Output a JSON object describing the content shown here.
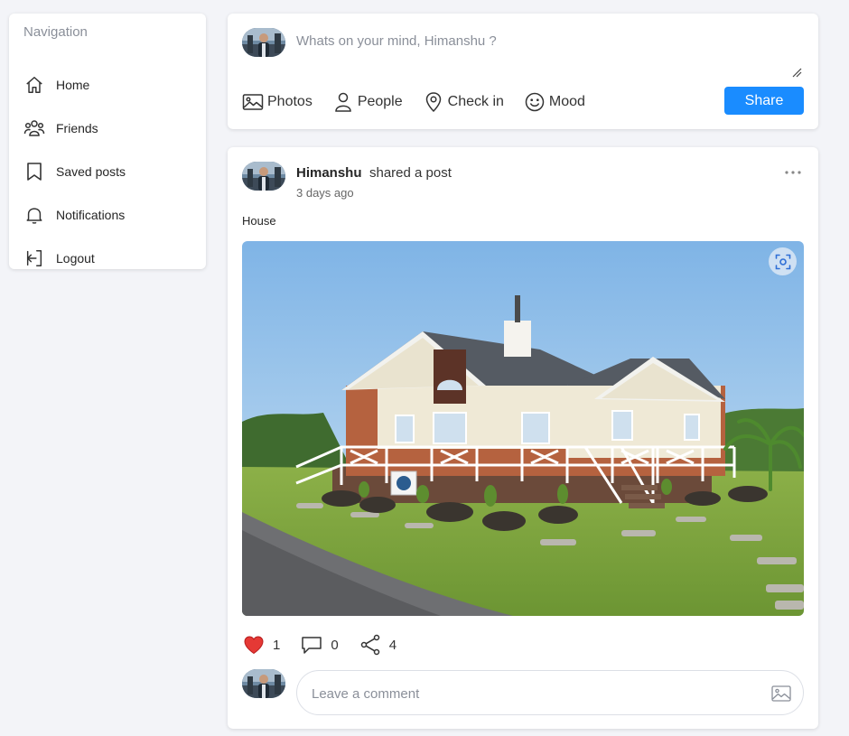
{
  "sidebar": {
    "title": "Navigation",
    "items": [
      {
        "label": "Home",
        "icon": "home-icon"
      },
      {
        "label": "Friends",
        "icon": "friends-icon"
      },
      {
        "label": "Saved posts",
        "icon": "bookmark-icon"
      },
      {
        "label": "Notifications",
        "icon": "bell-icon"
      },
      {
        "label": "Logout",
        "icon": "logout-icon"
      }
    ]
  },
  "composer": {
    "placeholder": "Whats on your mind, Himanshu ?",
    "actions": [
      {
        "label": "Photos",
        "icon": "image-icon"
      },
      {
        "label": "People",
        "icon": "person-icon"
      },
      {
        "label": "Check in",
        "icon": "location-pin-icon"
      },
      {
        "label": "Mood",
        "icon": "smiley-icon"
      }
    ],
    "share_label": "Share"
  },
  "post": {
    "author": "Himanshu",
    "action_text": "shared a post",
    "time": "3 days ago",
    "caption": "House",
    "likes": "1",
    "comments": "0",
    "shares": "4",
    "comment_placeholder": "Leave a comment"
  },
  "colors": {
    "accent": "#1a8cff",
    "like": "#e53935",
    "background": "#f3f4f8"
  }
}
